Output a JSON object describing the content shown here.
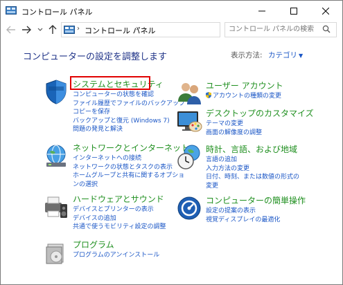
{
  "window": {
    "title": "コントロール パネル",
    "controls": {
      "minimize": "—",
      "maximize": "☐",
      "close": "✕"
    }
  },
  "address": {
    "path": "コントロール パネル",
    "separator": "›",
    "search_placeholder": "コントロール パネルの検索"
  },
  "content": {
    "heading": "コンピューターの設定を調整します",
    "view_by_label": "表示方法:",
    "view_by_value": "カテゴリ"
  },
  "categories": [
    {
      "title": "システムとセキュリティ",
      "icon": "shield-icon",
      "highlighted": true,
      "links": [
        "コンピューターの状態を確認",
        "ファイル履歴でファイルのバックアップ",
        "コピーを保存",
        "バックアップと復元 (Windows 7)",
        "問題の発見と解決"
      ]
    },
    {
      "title": "ネットワークとインターネット",
      "icon": "network-globe-icon",
      "links": [
        "インターネットへの接続",
        "ネットワークの状態とタスクの表示",
        "ホームグループと共有に関するオプショ",
        "ンの選択"
      ]
    },
    {
      "title": "ハードウェアとサウンド",
      "icon": "printer-speaker-icon",
      "links": [
        "デバイスとプリンターの表示",
        "デバイスの追加",
        "共通で使うモビリティ設定の調整"
      ]
    },
    {
      "title": "プログラム",
      "icon": "programs-disc-icon",
      "links": [
        "プログラムのアンインストール"
      ]
    },
    {
      "title": "ユーザー アカウント",
      "icon": "users-icon",
      "links": [
        "アカウントの種類の変更"
      ]
    },
    {
      "title": "デスクトップのカスタマイズ",
      "icon": "monitor-palette-icon",
      "links": [
        "テーマの変更",
        "画面の解像度の調整"
      ]
    },
    {
      "title": "時計、言語、および地域",
      "icon": "clock-globe-icon",
      "links": [
        "言語の追加",
        "入力方法の変更",
        "日付、時刻、または数値の形式の",
        "変更"
      ]
    },
    {
      "title": "コンピューターの簡単操作",
      "icon": "ease-of-access-icon",
      "links": [
        "設定の提案の表示",
        "視覚ディスプレイの最適化"
      ]
    }
  ],
  "colors": {
    "category_title": "#1f8f1f",
    "link": "#1a56c6",
    "heading": "#1e3287",
    "highlight": "#e00000"
  }
}
